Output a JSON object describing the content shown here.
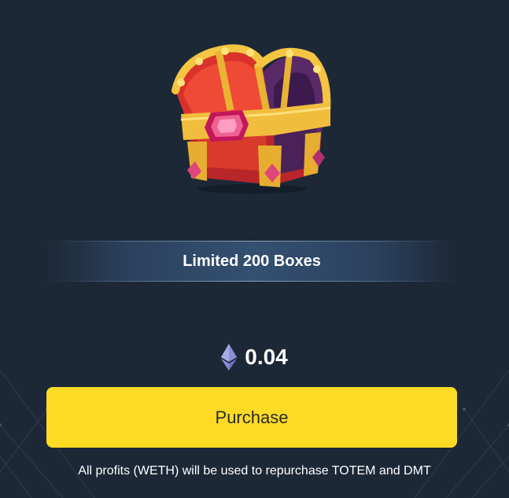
{
  "box": {
    "image_icon": "treasure-chest-icon",
    "title": "Limited 200 Boxes"
  },
  "price": {
    "currency_icon": "ethereum-icon",
    "value": "0.04"
  },
  "actions": {
    "purchase_label": "Purchase"
  },
  "footer": {
    "note": "All profits (WETH) will be used to repurchase TOTEM and DMT"
  },
  "colors": {
    "background": "#1d2837",
    "button": "#fddb25",
    "text": "#ffffff"
  }
}
